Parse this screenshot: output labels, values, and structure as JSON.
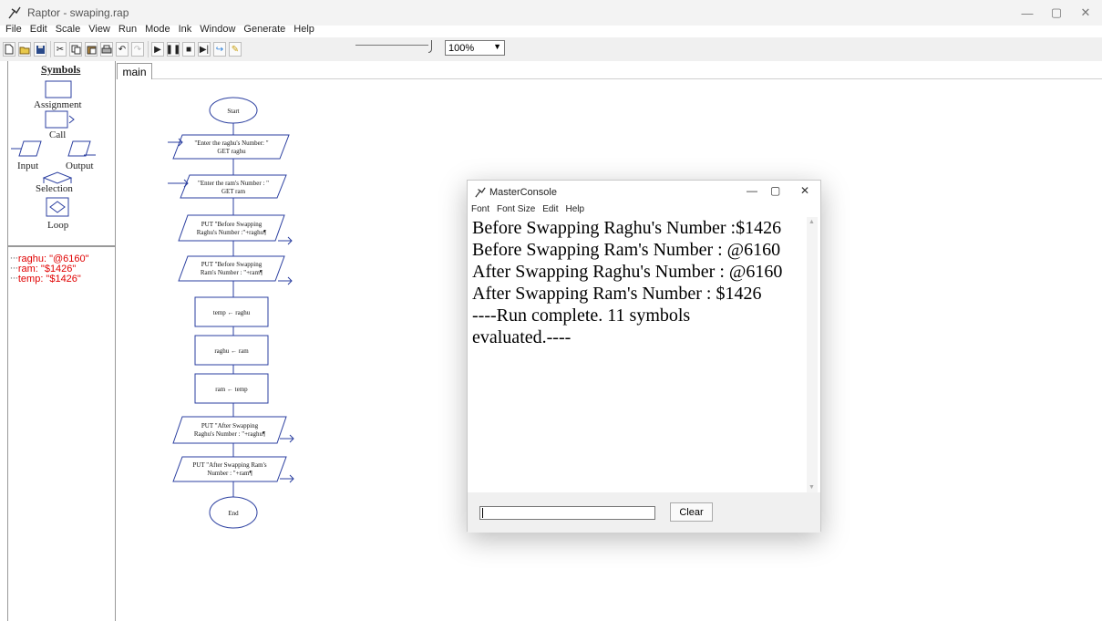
{
  "window": {
    "title": "Raptor - swaping.rap",
    "controls": [
      "—",
      "▢",
      "✕"
    ]
  },
  "menu": [
    "File",
    "Edit",
    "Scale",
    "View",
    "Run",
    "Mode",
    "Ink",
    "Window",
    "Generate",
    "Help"
  ],
  "toolbar": {
    "buttons": [
      "new-icon",
      "open-icon",
      "save-icon",
      "cut-icon",
      "copy-icon",
      "paste-icon",
      "print-icon",
      "undo-icon",
      "redo-icon",
      "play-icon",
      "pause-icon",
      "stop-icon",
      "step-icon",
      "step-into-icon",
      "pen-icon"
    ],
    "zoom_value": "100%"
  },
  "symbols": {
    "header": "Symbols",
    "assignment": "Assignment",
    "call": "Call",
    "input": "Input",
    "output": "Output",
    "selection": "Selection",
    "loop": "Loop"
  },
  "variables": [
    "raghu: \"@6160\"",
    "ram: \"$1426\"",
    "temp: \"$1426\""
  ],
  "tab": {
    "label": "main"
  },
  "flowchart": {
    "start": "Start",
    "in1_l1": "\"Enter the raghu's Number: \"",
    "in1_l2": "GET raghu",
    "in2_l1": "\"Enter the ram's Number : \"",
    "in2_l2": "GET ram",
    "out1_l1": "PUT \"Before Swapping",
    "out1_l2": "Raghu's Number :\"+raghu¶",
    "out2_l1": "PUT \"Before Swapping",
    "out2_l2": "Ram's Number : \"+ram¶",
    "a1": "temp ← raghu",
    "a2": "raghu ← ram",
    "a3": "ram ← temp",
    "out3_l1": "PUT \"After Swapping",
    "out3_l2": "Raghu's Number : \"+raghu¶",
    "out4_l1": "PUT \"After Swapping Ram's",
    "out4_l2": "Number : \"+ram¶",
    "end": "End"
  },
  "console": {
    "title": "MasterConsole",
    "menu": [
      "Font",
      "Font Size",
      "Edit",
      "Help"
    ],
    "output": [
      "Before Swapping Raghu's Number :$1426",
      "Before Swapping Ram's Number : @6160",
      "After Swapping Raghu's Number : @6160",
      "After Swapping Ram's Number : $1426",
      "----Run complete.  11 symbols",
      "evaluated.----"
    ],
    "clear_label": "Clear"
  }
}
